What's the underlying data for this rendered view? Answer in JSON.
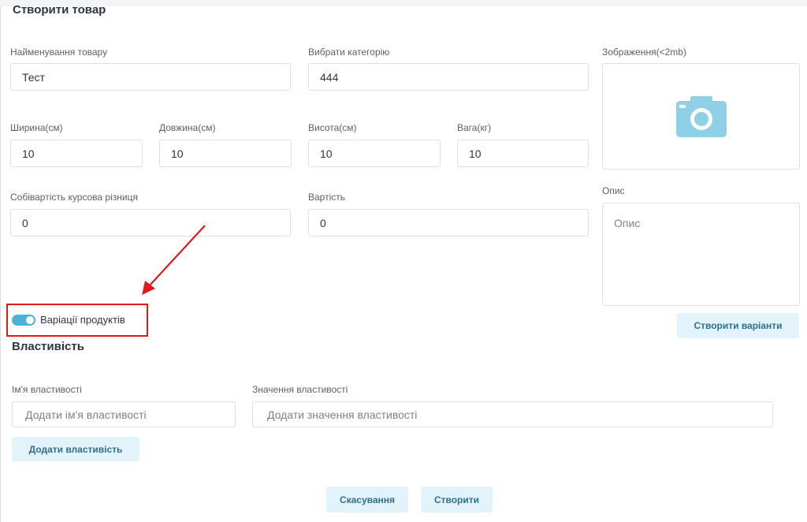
{
  "form": {
    "title": "Створити товар",
    "name_label": "Найменування товару",
    "name_value": "Тест",
    "category_label": "Вибрати категорію",
    "category_value": "444",
    "image_label": "Зображення(<2mb)",
    "width_label": "Ширина(см)",
    "width_value": "10",
    "length_label": "Довжина(см)",
    "length_value": "10",
    "height_label": "Висота(см)",
    "height_value": "10",
    "weight_label": "Вага(кг)",
    "weight_value": "10",
    "cost_label": "Собівартість курсова різниця",
    "cost_value": "0",
    "price_label": "Вартість",
    "price_value": "0",
    "description_label": "Опис",
    "description_placeholder": "Опис",
    "variations_toggle_label": "Варіації продуктів",
    "variations_enabled": true,
    "create_variants_button": "Створити варіанти"
  },
  "properties": {
    "title": "Властивість",
    "name_label": "Ім'я властивості",
    "name_placeholder": "Додати ім'я властивості",
    "value_label": "Значення властивості",
    "value_placeholder": "Додати значення властивості",
    "add_button": "Додати властивість"
  },
  "actions": {
    "cancel": "Скасування",
    "create": "Створити"
  },
  "colors": {
    "accent": "#4bb3d6",
    "button_bg": "#e3f3fb",
    "annotation": "#e0191b"
  }
}
